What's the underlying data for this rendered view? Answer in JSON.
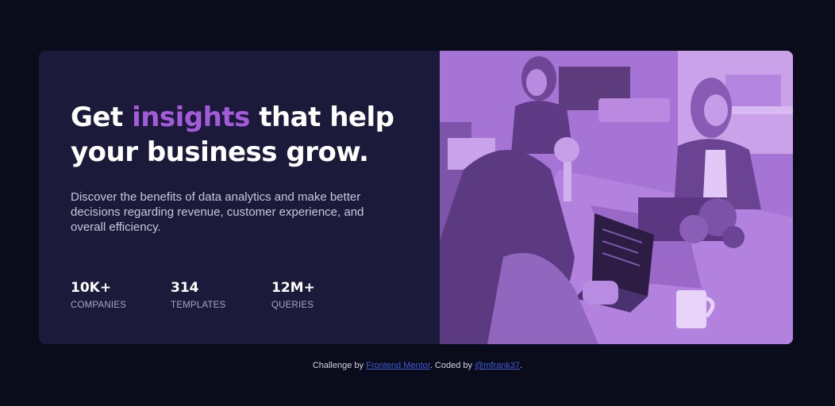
{
  "hero": {
    "headline_pre": "Get ",
    "headline_accent": "insights",
    "headline_post": " that help your business grow.",
    "description": "Discover the benefits of data analytics and make better decisions regarding revenue, customer experience, and overall efficiency.",
    "accent_color": "#a35bd9"
  },
  "stats": [
    {
      "value": "10K+",
      "label": "COMPANIES"
    },
    {
      "value": "314",
      "label": "TEMPLATES"
    },
    {
      "value": "12M+",
      "label": "QUERIES"
    }
  ],
  "image": {
    "description_icon": "office-photo",
    "overlay_color": "#a978d8"
  },
  "footer": {
    "challenge_prefix": "Challenge by ",
    "challenge_link": "Frontend Mentor",
    "coded_prefix": ". Coded by ",
    "coded_link": "@mfrank37",
    "suffix": "."
  },
  "colors": {
    "background": "#0a0c1b",
    "card": "#1b1a3b",
    "link": "#3f5bd6"
  }
}
